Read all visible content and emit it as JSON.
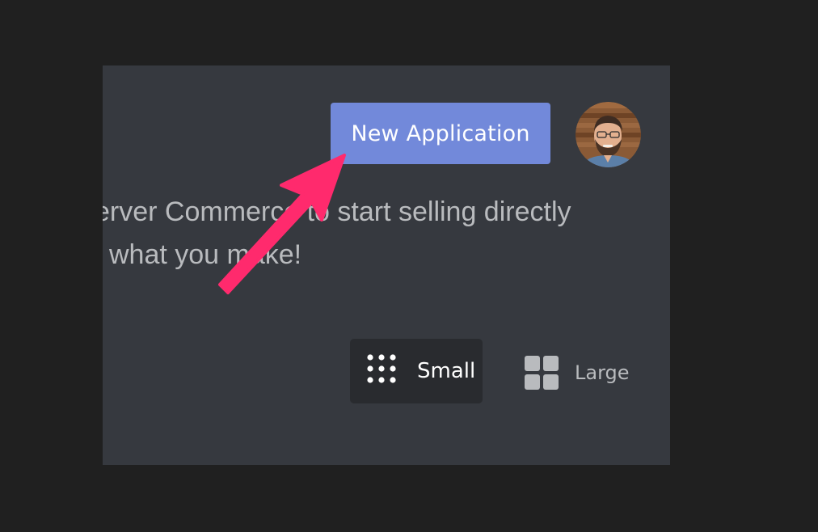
{
  "header": {
    "new_application_label": "New Application"
  },
  "description": {
    "line1": "erver Commerce to start selling directly",
    "line2": "what you make!"
  },
  "view_toggle": {
    "small_label": "Small",
    "large_label": "Large",
    "selected": "Small"
  },
  "icons": {
    "small": "dots-grid-icon",
    "large": "large-grid-icon",
    "annotation": "arrow-annotation"
  },
  "colors": {
    "page_background": "#202020",
    "panel_background": "#36393f",
    "button_blurple": "#7289da",
    "toggle_selected_bg": "#292b2f",
    "muted_text": "#b9bbbe",
    "arrow": "#ff2a6d"
  }
}
